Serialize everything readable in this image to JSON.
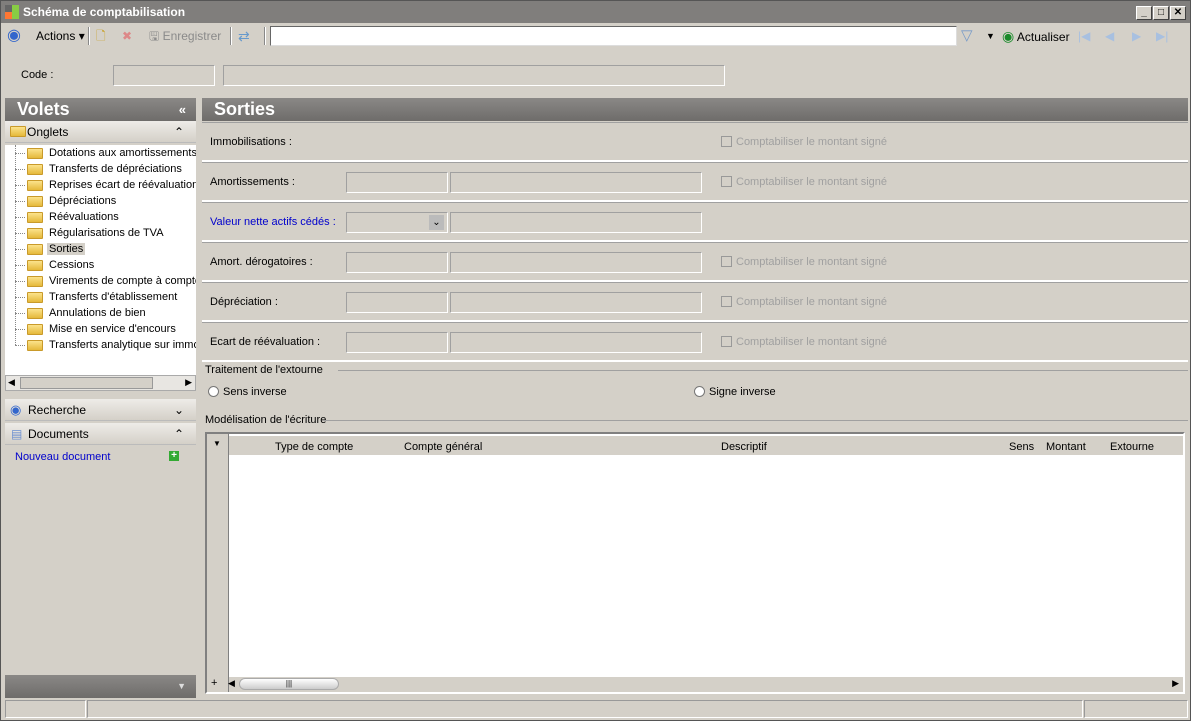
{
  "window": {
    "title": "Schéma de comptabilisation"
  },
  "toolbar": {
    "actions": "Actions",
    "save": "Enregistrer",
    "search_value": "",
    "refresh": "Actualiser"
  },
  "header": {
    "code_label": "Code :",
    "code_value": "",
    "code_desc": ""
  },
  "left": {
    "title": "Volets",
    "onglets": "Onglets",
    "tree": [
      "Dotations aux amortissements",
      "Transferts de dépréciations",
      "Reprises écart de réévaluation",
      "Dépréciations",
      "Réévaluations",
      "Régularisations de TVA",
      "Sorties",
      "Cessions",
      "Virements de compte à compte",
      "Transferts d'établissement",
      "Annulations de bien",
      "Mise en service d'encours",
      "Transferts analytique sur immo"
    ],
    "selected": "Sorties",
    "recherche": "Recherche",
    "documents": "Documents",
    "new_doc": "Nouveau document"
  },
  "main": {
    "title": "Sorties",
    "rows": [
      {
        "label": "Immobilisations :",
        "fields": false,
        "check": "Comptabiliser le montant signé"
      },
      {
        "label": "Amortissements :",
        "fields": true,
        "check": "Comptabiliser le montant signé"
      },
      {
        "label": "Valeur nette actifs cédés :",
        "fields": true,
        "combo": true,
        "check": null
      },
      {
        "label": "Amort. dérogatoires :",
        "fields": true,
        "check": "Comptabiliser le montant signé"
      },
      {
        "label": "Dépréciation :",
        "fields": true,
        "check": "Comptabiliser le montant signé"
      },
      {
        "label": "Ecart de réévaluation :",
        "fields": true,
        "check": "Comptabiliser le montant signé"
      }
    ],
    "extourne": {
      "title": "Traitement de l'extourne",
      "opt1": "Sens inverse",
      "opt2": "Signe inverse"
    },
    "grid": {
      "title": "Modélisation de l'écriture",
      "columns": [
        "Type de compte",
        "Compte général",
        "Descriptif",
        "Sens",
        "Montant",
        "Extourne"
      ]
    }
  },
  "colors": {
    "link": "#0000cc",
    "accent": "#3366cc"
  }
}
